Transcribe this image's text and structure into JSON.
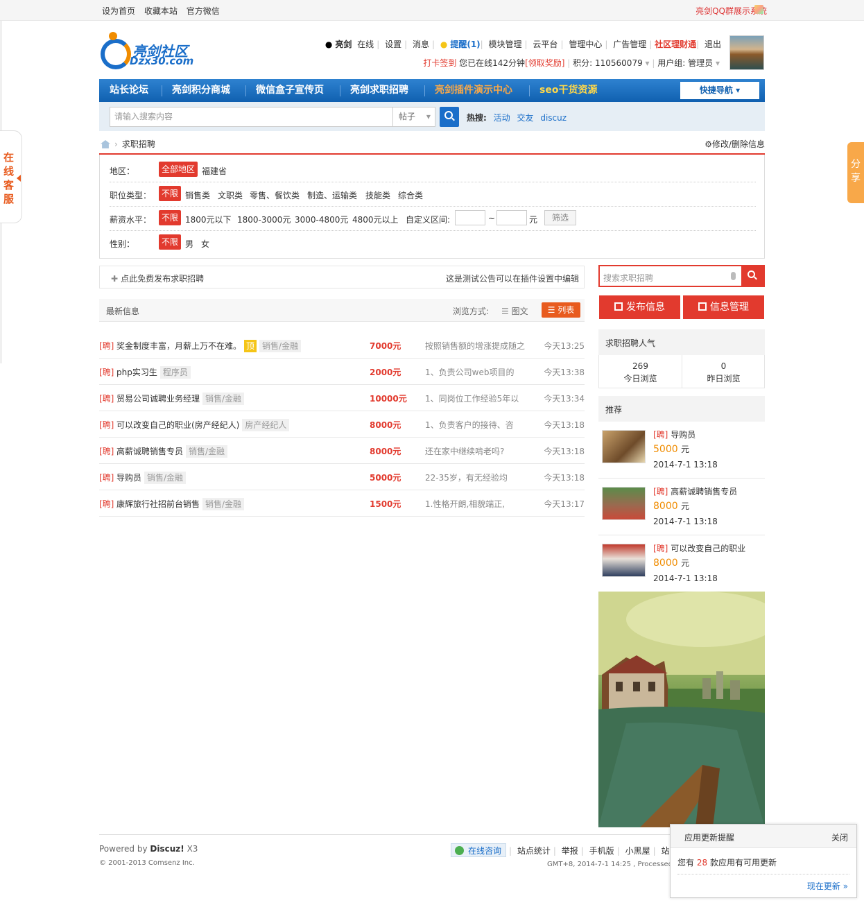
{
  "topbar": {
    "links": [
      "设为首页",
      "收藏本站",
      "官方微信"
    ],
    "right_link": "亮剑QQ群展示系统"
  },
  "logo": {
    "cn": "亮剑社区",
    "en": "Dzx30.com"
  },
  "user_menu": {
    "username": "亮剑",
    "online": "在线",
    "items": [
      "设置",
      "消息"
    ],
    "remind": "提醒(1)",
    "items2": [
      "模块管理",
      "云平台",
      "管理中心",
      "广告管理"
    ],
    "finance": "社区理财通",
    "logout": "退出"
  },
  "user_info": {
    "checkin": "打卡签到",
    "online_time": "您已在线142分钟",
    "reward": "[领取奖励]",
    "points_label": "积分: 110560079",
    "group_label": "用户组: 管理员"
  },
  "nav": {
    "items": [
      "站长论坛",
      "亮剑积分商城",
      "微信盒子宣传页",
      "亮剑求职招聘",
      "亮剑插件演示中心",
      "seo干货资源"
    ],
    "quick": "快捷导航"
  },
  "search": {
    "placeholder": "请输入搜索内容",
    "type": "帖子",
    "hot_label": "热搜:",
    "hot_words": [
      "活动",
      "交友",
      "discuz"
    ]
  },
  "breadcrumb": {
    "current": "求职招聘",
    "edit": "修改/删除信息"
  },
  "filter": {
    "region": {
      "label": "地区：",
      "selected": "全部地区",
      "options": [
        "福建省"
      ]
    },
    "job_type": {
      "label": "职位类型：",
      "selected": "不限",
      "options": [
        "销售类",
        "文职类",
        "零售、餐饮类",
        "制造、运输类",
        "技能类",
        "综合类"
      ]
    },
    "salary": {
      "label": "薪资水平：",
      "selected": "不限",
      "options": [
        "1800元以下",
        "1800-3000元",
        "3000-4800元",
        "4800元以上"
      ],
      "custom_label": "自定义区间:",
      "tilde": "~",
      "unit": "元",
      "button": "筛选"
    },
    "gender": {
      "label": "性别：",
      "selected": "不限",
      "options": [
        "男",
        "女"
      ]
    }
  },
  "publish": {
    "link": "点此免费发布求职招聘",
    "notice": "这是测试公告可以在插件设置中编辑"
  },
  "list_header": {
    "title": "最新信息",
    "view_mode": "浏览方式:",
    "grid": "图文",
    "list": "列表"
  },
  "listings": [
    {
      "prefix": "[聘]",
      "title": "奖金制度丰富，月薪上万不在难。",
      "top": "顶",
      "tag": "销售/金融",
      "pay": "7000元",
      "desc": "按照销售额的增涨提成随之",
      "time": "今天13:25"
    },
    {
      "prefix": "[聘]",
      "title": "php实习生",
      "tag": "程序员",
      "pay": "2000元",
      "desc": "1、负责公司web项目的",
      "time": "今天13:38"
    },
    {
      "prefix": "[聘]",
      "title": "贸易公司诚聘业务经理",
      "tag": "销售/金融",
      "pay": "10000元",
      "desc": "1、同岗位工作经验5年以",
      "time": "今天13:34"
    },
    {
      "prefix": "[聘]",
      "title": "可以改变自己的职业(房产经纪人)",
      "tag": "房产经纪人",
      "pay": "8000元",
      "desc": "1、负责客户的接待、咨",
      "time": "今天13:18"
    },
    {
      "prefix": "[聘]",
      "title": "高薪诚聘销售专员",
      "tag": "销售/金融",
      "pay": "8000元",
      "desc": "还在家中继续啃老吗?",
      "time": "今天13:18"
    },
    {
      "prefix": "[聘]",
      "title": "导购员",
      "tag": "销售/金融",
      "pay": "5000元",
      "desc": "22-35岁，有无经验均",
      "time": "今天13:18"
    },
    {
      "prefix": "[聘]",
      "title": "康辉旅行社招前台销售",
      "tag": "销售/金融",
      "pay": "1500元",
      "desc": "1.性格开朗,相貌端正,",
      "time": "今天13:17"
    }
  ],
  "sidebar": {
    "search_placeholder": "搜索求职招聘",
    "publish_btn": "发布信息",
    "manage_btn": "信息管理",
    "popularity_title": "求职招聘人气",
    "today_count": "269",
    "today_label": "今日浏览",
    "yesterday_count": "0",
    "yesterday_label": "昨日浏览",
    "recommend_title": "推荐",
    "recommend": [
      {
        "prefix": "[聘]",
        "title": "导购员",
        "pay": "5000",
        "unit": "元",
        "date": "2014-7-1 13:18"
      },
      {
        "prefix": "[聘]",
        "title": "高薪诚聘销售专员",
        "pay": "8000",
        "unit": "元",
        "date": "2014-7-1 13:18"
      },
      {
        "prefix": "[聘]",
        "title": "可以改变自己的职业",
        "pay": "8000",
        "unit": "元",
        "date": "2014-7-1 13:18"
      }
    ]
  },
  "footer": {
    "powered": "Powered by",
    "brand": "Discuz!",
    "version": "X3",
    "copyright": "© 2001-2013 Comsenz Inc.",
    "online_consult": "在线咨询",
    "links": [
      "站点统计",
      "举报",
      "手机版",
      "小黑屋",
      "站"
    ],
    "gmt": "GMT+8, 2014-7-1 14:25 , Processed in 0"
  },
  "notify": {
    "title": "应用更新提醒",
    "close": "关闭",
    "text_pre": "您有",
    "count": "28",
    "text_post": "款应用有可用更新",
    "update": "现在更新 »"
  },
  "side": {
    "kefu": "在线客服",
    "share": "分享"
  }
}
